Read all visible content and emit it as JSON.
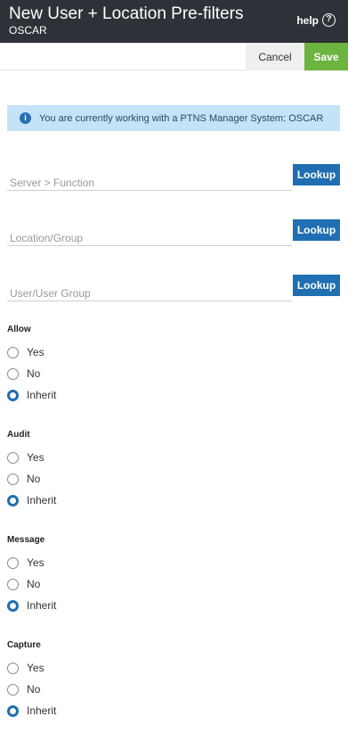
{
  "header": {
    "title": "New User + Location Pre-filters",
    "subtitle": "OSCAR",
    "help_label": "help",
    "help_icon": "question-circle-icon"
  },
  "actions": {
    "cancel_label": "Cancel",
    "save_label": "Save",
    "save_color": "#6db33f"
  },
  "info": {
    "icon": "info-icon",
    "message": "You are currently working with a PTNS Manager System: OSCAR"
  },
  "fields": [
    {
      "placeholder": "Server > Function",
      "value": "",
      "button_label": "Lookup"
    },
    {
      "placeholder": "Location/Group",
      "value": "",
      "button_label": "Lookup"
    },
    {
      "placeholder": "User/User Group",
      "value": "",
      "button_label": "Lookup"
    }
  ],
  "radio_groups": [
    {
      "label": "Allow",
      "options": [
        "Yes",
        "No",
        "Inherit"
      ],
      "selected": "Inherit"
    },
    {
      "label": "Audit",
      "options": [
        "Yes",
        "No",
        "Inherit"
      ],
      "selected": "Inherit"
    },
    {
      "label": "Message",
      "options": [
        "Yes",
        "No",
        "Inherit"
      ],
      "selected": "Inherit"
    },
    {
      "label": "Capture",
      "options": [
        "Yes",
        "No",
        "Inherit"
      ],
      "selected": "Inherit"
    }
  ],
  "colors": {
    "header_bg": "#2d3238",
    "accent": "#1f6fb2",
    "info_bg": "#c4e3f8"
  }
}
